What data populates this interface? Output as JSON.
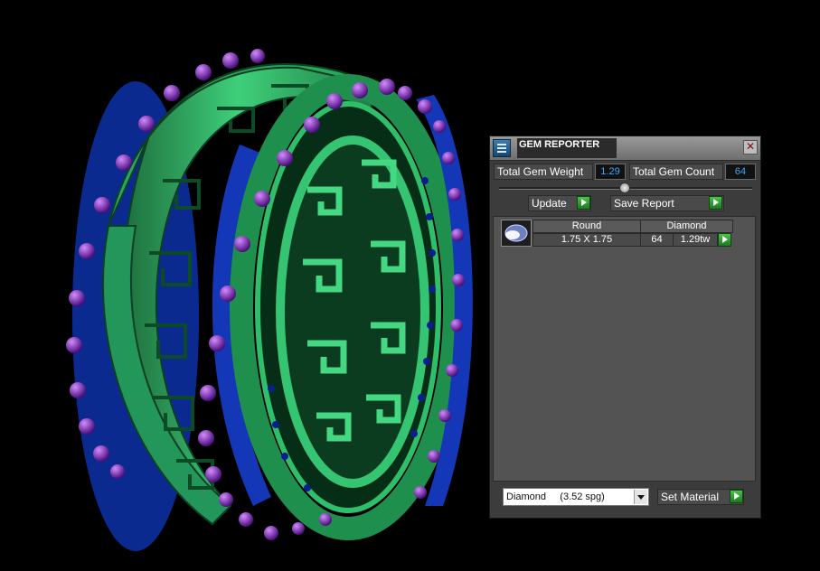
{
  "panel": {
    "title": "GEM REPORTER",
    "close_label": "✕",
    "total_gem_weight_label": "Total Gem Weight",
    "total_gem_weight_value": "1.29",
    "total_gem_count_label": "Total Gem Count",
    "total_gem_count_value": "64",
    "update_label": "Update",
    "save_report_label": "Save Report",
    "gem_row": {
      "shape": "Round",
      "material": "Diamond",
      "size": "1.75 X 1.75",
      "count": "64",
      "weight": "1.29tw"
    },
    "material_select_value": "Diamond     (3.52 spg)",
    "set_material_label": "Set Material"
  },
  "colors": {
    "ring_green": "#2fb86a",
    "gem_blue": "#1a4cd8",
    "prong_purple": "#8a2bc8",
    "accent_green": "#2e9b2e",
    "value_blue": "#39a7ff"
  },
  "icons": {
    "title": "gem-reporter-icon",
    "close": "close-icon",
    "arrow": "play-arrow-icon",
    "dropdown": "chevron-down-icon"
  }
}
